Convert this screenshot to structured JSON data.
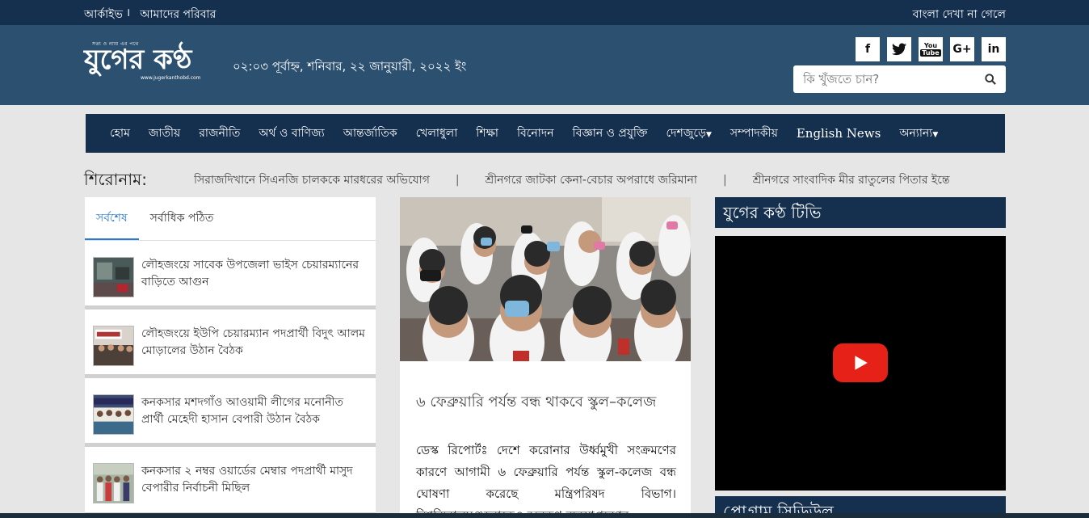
{
  "topbar": {
    "archive": "আর্কাইভ",
    "separator": "।",
    "family": "আমাদের পরিবার",
    "font_help": "বাংলা দেখা না গেলে"
  },
  "logo": {
    "tagline": "সত্য ও ন্যায় এর পথে",
    "name": "যুগের কণ্ঠ",
    "url": "www.jugerkanthobd.com"
  },
  "datetime": "০২:০৩ পূর্বাহ্ন, শনিবার, ২২ জানুয়ারী, ২০২২ ইং",
  "social": {
    "facebook": "f",
    "twitter": "t",
    "youtube_top": "You",
    "youtube_bottom": "Tube",
    "gplus": "G+",
    "linkedin": "in"
  },
  "search": {
    "placeholder": "কি খুঁজতে চান?"
  },
  "nav": {
    "items": [
      "হোম",
      "জাতীয়",
      "রাজনীতি",
      "অর্থ ও বাণিজ্য",
      "আন্তর্জাতিক",
      "খেলাধুলা",
      "শিক্ষা",
      "বিনোদন",
      "বিজ্ঞান ও প্রযুক্তি",
      "দেশজুড়ে",
      "সম্পাদকীয়",
      "English News",
      "অন্যান্য"
    ]
  },
  "ticker": {
    "label": "শিরোনাম:",
    "items": [
      "সিরাজদিখানে সিএনজি চালককে মারধরের অভিযোগ",
      "শ্রীনগরে জাটকা কেনা-বেচার অপরাধে জরিমানা",
      "শ্রীনগরে সাংবাদিক মীর রাতুলের পিতার ইন্তে"
    ],
    "separator": "|"
  },
  "tabs": {
    "latest": "সর্বশেষ",
    "most_read": "সর্বাধিক পঠিত"
  },
  "latest_news": [
    {
      "title": "লৌহজংয়ে সাবেক উপজেলা ভাইস চেয়ারম্যানের বাড়িতে আগুন"
    },
    {
      "title": "লৌহজংয়ে ইউপি চেয়ারম্যান পদপ্রার্থী বিদুৎ আলম মোড়ালের উঠান বৈঠক"
    },
    {
      "title": "কনকসার মশদগাঁও আওয়ামী লীগের মনোনীত প্রার্থী মেহেদী হাসান বেপারী উঠান বৈঠক"
    },
    {
      "title": "কনকসার ২ নম্বর ওয়ার্ডের মেম্বার পদপ্রার্থী মাসুদ বেপারীর নির্বাচনী মিছিল"
    }
  ],
  "featured": {
    "title": "৬ ফেব্রুয়ারি পর্যন্ত বন্ধ থাকবে স্কুল–কলেজ",
    "body": "ডেস্ক রিপোর্টঃ দেশে করোনার উর্ধ্বমুখী সংক্রমণের কারণে আগামী ৬ ফেব্রুয়ারি পর্যন্ত স্কুল-কলেজ বন্ধ ঘোষণা করেছে মন্ত্রিপরিষদ বিভাগ। বিশ্ববিদ্যালয়গুলোকেও অনুরূপ ব্যবস্থাগ্রহণের"
  },
  "tv": {
    "title": "যুগের কণ্ঠ টিভি"
  },
  "schedule": {
    "title": "প্রোগ্রাম সিডিউল"
  },
  "colors": {
    "topbar": "#152f4e",
    "header": "#2c5070",
    "nav": "#152f4e",
    "accent": "#2a7ad5",
    "youtube_red": "#e62117"
  }
}
